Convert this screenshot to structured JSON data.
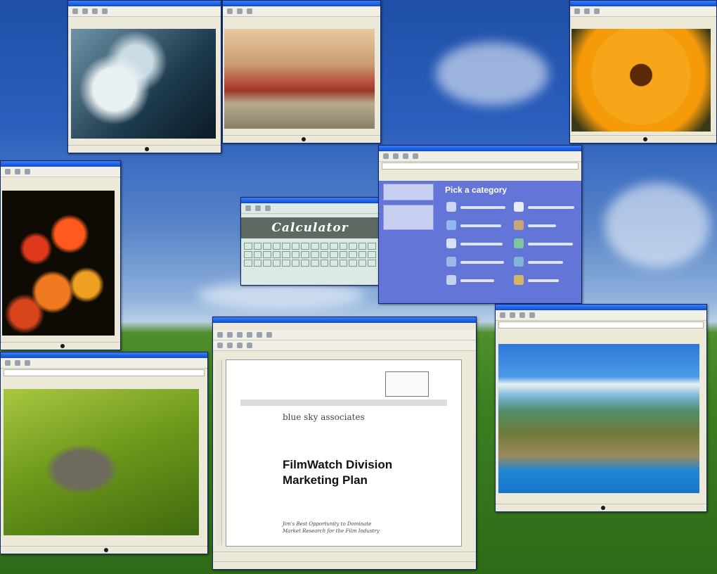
{
  "desktop": {
    "name": "Windows XP desktop"
  },
  "windows": {
    "calculator": {
      "title": "Calculator"
    },
    "control_panel": {
      "heading": "Pick a category"
    },
    "word": {
      "company": "blue sky associates",
      "doc_title_line1": "FilmWatch Division",
      "doc_title_line2": "Marketing Plan",
      "subtitle_line1": "Jim's Best Opportunity to Dominate",
      "subtitle_line2": "Market Research for the Film Industry"
    }
  },
  "colors": {
    "xp_blue": "#0a4bd6",
    "window_face": "#ece9d8",
    "category_bg": "#6375d6"
  }
}
